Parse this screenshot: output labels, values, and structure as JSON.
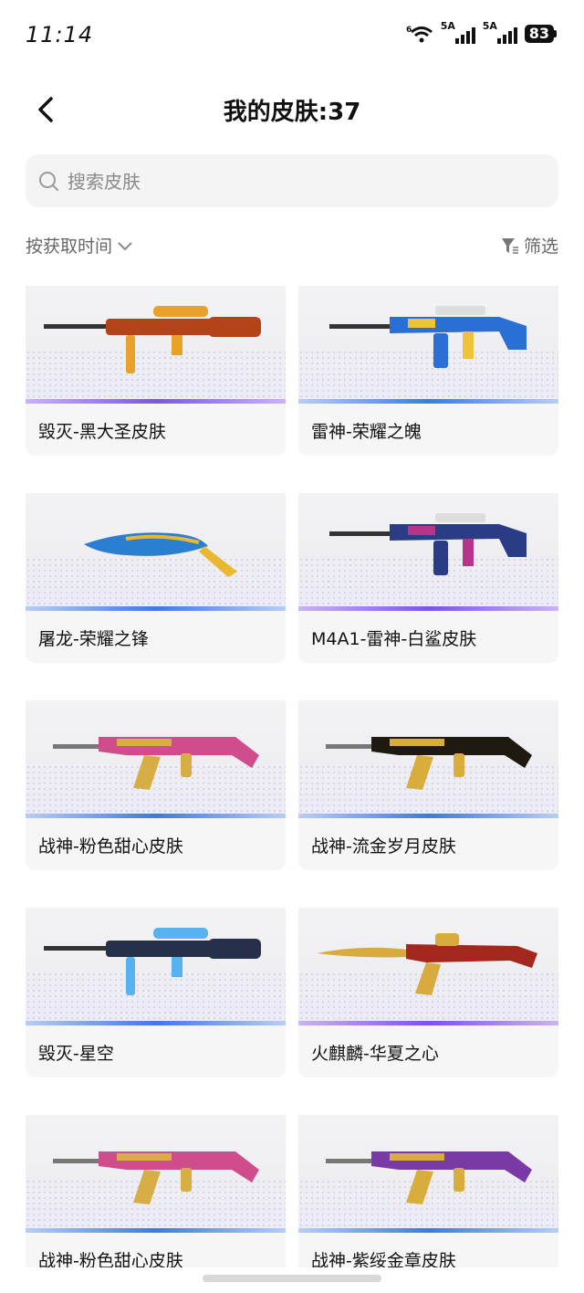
{
  "status": {
    "time": "11:14",
    "wifi_label": "6",
    "sim1": "5A",
    "sim2": "5A",
    "battery": "83"
  },
  "header": {
    "title": "我的皮肤:37"
  },
  "search": {
    "placeholder": "搜索皮肤"
  },
  "sort": {
    "label": "按获取时间"
  },
  "filter": {
    "label": "筛选"
  },
  "skins": [
    {
      "name": "毁灭-黑大圣皮肤",
      "weapon": "sniper",
      "colors": [
        "#b3441a",
        "#e8a22a"
      ],
      "accent": "purple"
    },
    {
      "name": "雷神-荣耀之魄",
      "weapon": "rifle",
      "colors": [
        "#2a6fd6",
        "#f0c238"
      ],
      "accent": "blue"
    },
    {
      "name": "屠龙-荣耀之锋",
      "weapon": "knife",
      "colors": [
        "#2b7fd0",
        "#e9b730"
      ],
      "accent": "blue"
    },
    {
      "name": "M4A1-雷神-白鲨皮肤",
      "weapon": "rifle",
      "colors": [
        "#2b3c86",
        "#b8338a"
      ],
      "accent": "purple"
    },
    {
      "name": "战神-粉色甜心皮肤",
      "weapon": "ak",
      "colors": [
        "#cf4d8c",
        "#d6ae45"
      ],
      "accent": "blue"
    },
    {
      "name": "战神-流金岁月皮肤",
      "weapon": "ak",
      "colors": [
        "#1e1a12",
        "#d9ad3c"
      ],
      "accent": "blue"
    },
    {
      "name": "毁灭-星空",
      "weapon": "sniper",
      "colors": [
        "#27304a",
        "#58b2f0"
      ],
      "accent": "blue"
    },
    {
      "name": "火麒麟-华夏之心",
      "weapon": "ak-blade",
      "colors": [
        "#a4271d",
        "#d9aa3d"
      ],
      "accent": "purple"
    },
    {
      "name": "战神-粉色甜心皮肤",
      "weapon": "ak",
      "colors": [
        "#cf4d8c",
        "#d6ae45"
      ],
      "accent": "blue"
    },
    {
      "name": "战神-紫绥金章皮肤",
      "weapon": "ak",
      "colors": [
        "#7a3aa6",
        "#d9ad3c"
      ],
      "accent": "blue"
    }
  ]
}
